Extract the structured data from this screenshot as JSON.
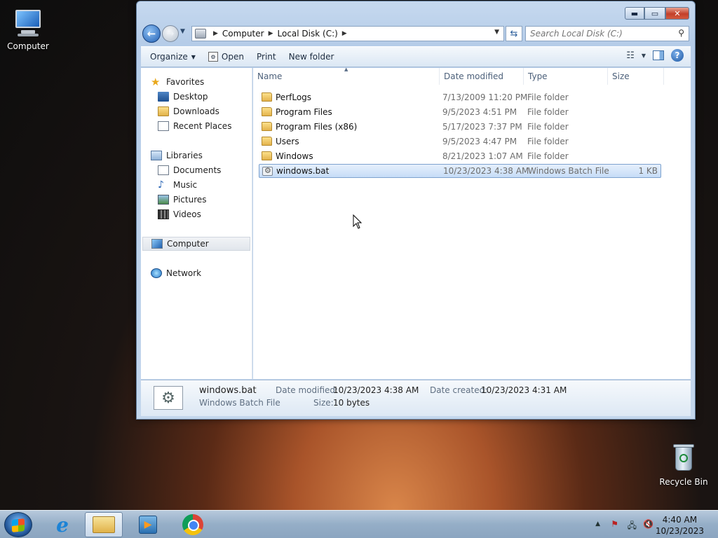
{
  "desktop": {
    "computer_label": "Computer",
    "recycle_label": "Recycle Bin"
  },
  "window": {
    "address": {
      "crumbs": [
        "Computer",
        "Local Disk (C:)"
      ],
      "search_placeholder": "Search Local Disk (C:)"
    },
    "toolbar": {
      "organize": "Organize",
      "open": "Open",
      "print": "Print",
      "new_folder": "New folder"
    },
    "nav": {
      "favorites": "Favorites",
      "desktop": "Desktop",
      "downloads": "Downloads",
      "recent": "Recent Places",
      "libraries": "Libraries",
      "documents": "Documents",
      "music": "Music",
      "pictures": "Pictures",
      "videos": "Videos",
      "computer": "Computer",
      "network": "Network"
    },
    "columns": {
      "name": "Name",
      "date": "Date modified",
      "type": "Type",
      "size": "Size"
    },
    "files": [
      {
        "name": "PerfLogs",
        "date": "7/13/2009 11:20 PM",
        "type": "File folder",
        "size": ""
      },
      {
        "name": "Program Files",
        "date": "9/5/2023 4:51 PM",
        "type": "File folder",
        "size": ""
      },
      {
        "name": "Program Files (x86)",
        "date": "5/17/2023 7:37 PM",
        "type": "File folder",
        "size": ""
      },
      {
        "name": "Users",
        "date": "9/5/2023 4:47 PM",
        "type": "File folder",
        "size": ""
      },
      {
        "name": "Windows",
        "date": "8/21/2023 1:07 AM",
        "type": "File folder",
        "size": ""
      },
      {
        "name": "windows.bat",
        "date": "10/23/2023 4:38 AM",
        "type": "Windows Batch File",
        "size": "1 KB"
      }
    ],
    "details": {
      "name": "windows.bat",
      "type": "Windows Batch File",
      "modified_label": "Date modified:",
      "modified": "10/23/2023 4:38 AM",
      "created_label": "Date created:",
      "created": "10/23/2023 4:31 AM",
      "size_label": "Size:",
      "size": "10 bytes"
    }
  },
  "taskbar": {
    "time": "4:40 AM",
    "date": "10/23/2023"
  }
}
